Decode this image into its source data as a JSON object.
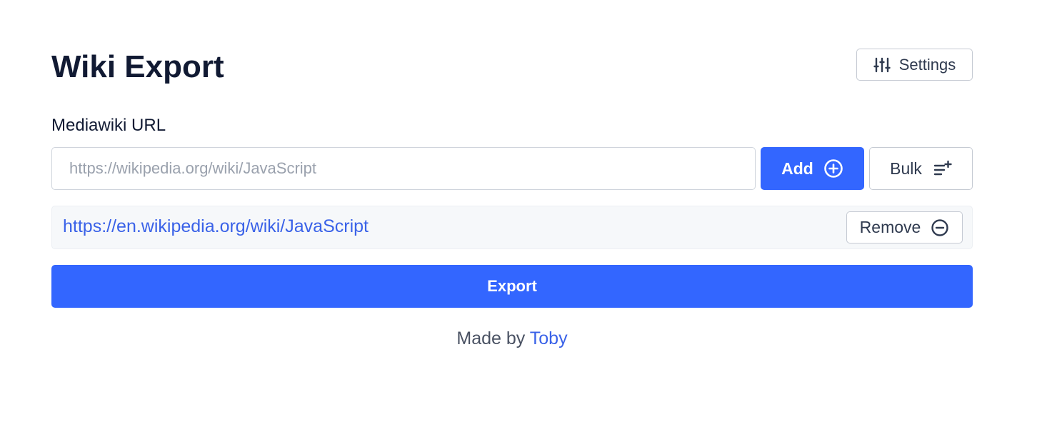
{
  "header": {
    "title": "Wiki Export",
    "settings_label": "Settings",
    "settings_icon": "sliders-icon"
  },
  "form": {
    "label": "Mediawiki URL",
    "input_placeholder": "https://wikipedia.org/wiki/JavaScript",
    "input_value": "",
    "add_label": "Add",
    "add_icon": "plus-circle-icon",
    "bulk_label": "Bulk",
    "bulk_icon": "list-add-icon"
  },
  "urls": [
    {
      "url": "https://en.wikipedia.org/wiki/JavaScript",
      "remove_label": "Remove",
      "remove_icon": "minus-circle-icon"
    }
  ],
  "export_label": "Export",
  "footer": {
    "prefix": "Made by",
    "author": "Toby"
  },
  "colors": {
    "primary": "#3366ff",
    "link": "#3a62e8",
    "heading": "#111a33",
    "item_background": "#f6f8fa"
  }
}
